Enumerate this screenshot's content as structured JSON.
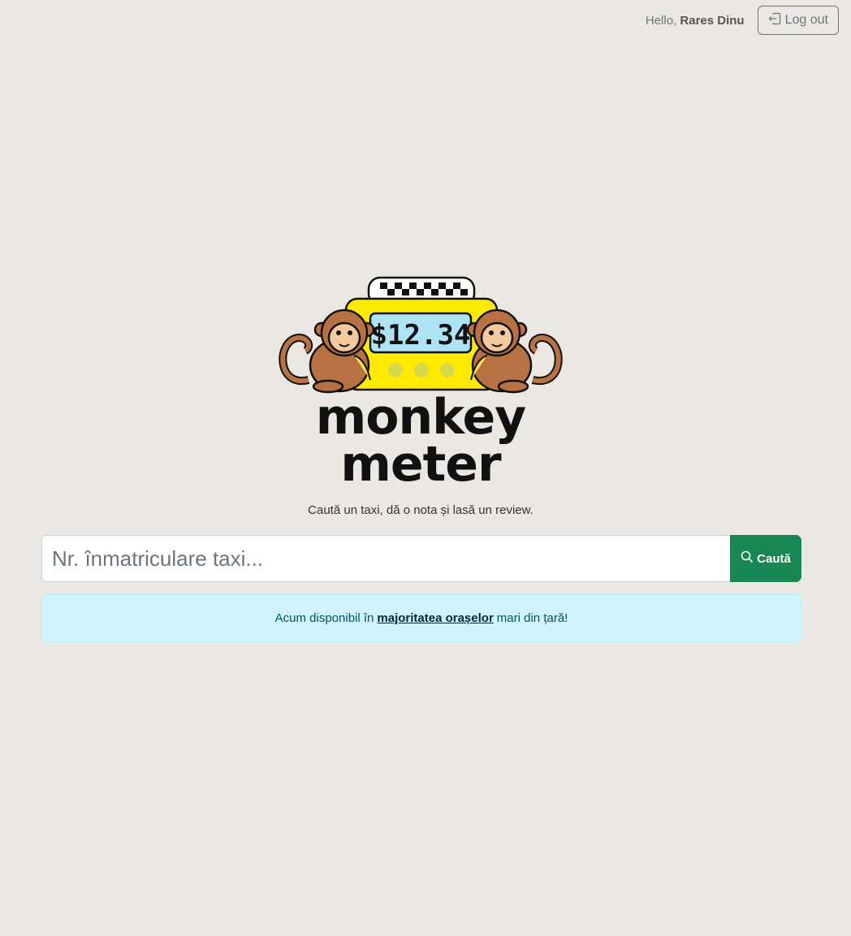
{
  "header": {
    "greeting_prefix": "Hello,",
    "user_name": "Rares Dinu",
    "logout_label": "Log out"
  },
  "logo": {
    "meter_display": "$12.34",
    "wordmark_line1": "monkey",
    "wordmark_line2": "meter",
    "icon": "taxi-meter-monkeys-logo"
  },
  "tagline": "Caută un taxi, dă o nota și lasă un review.",
  "search": {
    "placeholder": "Nr. înmatriculare taxi...",
    "value": "",
    "button_label": "Caută",
    "button_icon": "search-icon"
  },
  "alert": {
    "text_before": "Acum disponibil în",
    "link_text": "majoritatea orașelor",
    "text_after": "mari din țară!"
  },
  "colors": {
    "background": "#ebe8e4",
    "search_button": "#198754",
    "alert_bg": "#cff4fc",
    "logo_yellow": "#ffea00",
    "meter_screen": "#aee3f5",
    "monkey_brown": "#b87142"
  }
}
